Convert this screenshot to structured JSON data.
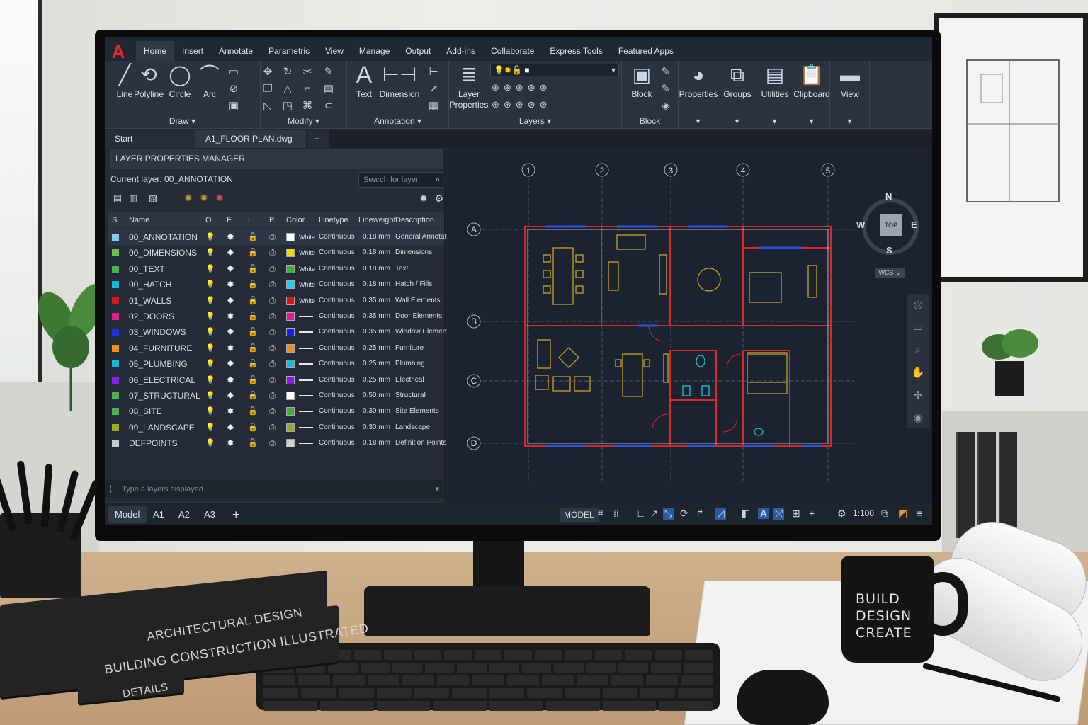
{
  "ribbon": {
    "tabs": [
      "Home",
      "Insert",
      "Annotate",
      "Parametric",
      "View",
      "Manage",
      "Output",
      "Add-ins",
      "Collaborate",
      "Express Tools",
      "Featured Apps"
    ],
    "draw": {
      "line": "Line",
      "polyline": "Polyline",
      "circle": "Circle",
      "arc": "Arc",
      "label": "Draw ▾"
    },
    "modify_label": "Modify ▾",
    "annotation": {
      "text": "Text",
      "dimension": "Dimension",
      "label": "Annotation ▾"
    },
    "layers": {
      "props_line1": "Layer",
      "props_line2": "Properties",
      "label": "Layers ▾"
    },
    "block": {
      "block": "Block",
      "label": "Block"
    },
    "properties": "Properties",
    "groups": "Groups",
    "utilities": "Utilities",
    "clipboard": "Clipboard",
    "view": "View"
  },
  "doc_tabs": {
    "start": "Start",
    "file": "A1_FLOOR PLAN.dwg",
    "close": "×",
    "add": "+"
  },
  "layer_manager": {
    "title": "LAYER PROPERTIES MANAGER",
    "current": "Current layer: 00_ANNOTATION",
    "search_placeholder": "Search for layer",
    "headers": {
      "s": "S..",
      "name": "Name",
      "o": "O.",
      "f": "F.",
      "l": "L.",
      "p": "P.",
      "color": "Color",
      "linetype": "Linetype",
      "lineweight": "Lineweight",
      "description": "Description"
    },
    "rows": [
      {
        "name": "00_ANNOTATION",
        "status_color": "#7fcfe8",
        "color": "#ffffff",
        "color_name": "White",
        "linetype": "Continuous",
        "lineweight": "0.18 mm",
        "description": "General Annotation"
      },
      {
        "name": "00_DIMENSIONS",
        "status_color": "#6ac04a",
        "color": "#f3d400",
        "color_name": "White",
        "linetype": "Continuous",
        "lineweight": "0.18 mm",
        "description": "Dimensions"
      },
      {
        "name": "00_TEXT",
        "status_color": "#4caf50",
        "color": "#3fae3a",
        "color_name": "White",
        "linetype": "Continuous",
        "lineweight": "0.18 mm",
        "description": "Text"
      },
      {
        "name": "00_HATCH",
        "status_color": "#19b5d8",
        "color": "#19d0e8",
        "color_name": "White",
        "linetype": "Continuous",
        "lineweight": "0.18 mm",
        "description": "Hatch / Fills"
      },
      {
        "name": "01_WALLS",
        "status_color": "#d11a1a",
        "color": "#e01010",
        "color_name": "White",
        "linetype": "Continuous",
        "lineweight": "0.35 mm",
        "description": "Wall Elements"
      },
      {
        "name": "02_DOORS",
        "status_color": "#e0208a",
        "color": "#e01c8c",
        "color_name": "",
        "linetype": "Continuous",
        "lineweight": "0.35 mm",
        "description": "Door Elements"
      },
      {
        "name": "03_WINDOWS",
        "status_color": "#2030e0",
        "color": "#1a1ae8",
        "color_name": "",
        "linetype": "Continuous",
        "lineweight": "0.35 mm",
        "description": "Window Elements"
      },
      {
        "name": "04_FURNITURE",
        "status_color": "#f08a18",
        "color": "#f08a18",
        "color_name": "",
        "linetype": "Continuous",
        "lineweight": "0.25 mm",
        "description": "Furniture"
      },
      {
        "name": "05_PLUMBING",
        "status_color": "#19b5d8",
        "color": "#19b8e0",
        "color_name": "",
        "linetype": "Continuous",
        "lineweight": "0.25 mm",
        "description": "Plumbing"
      },
      {
        "name": "06_ELECTRICAL",
        "status_color": "#8a20e0",
        "color": "#8a18e8",
        "color_name": "",
        "linetype": "Continuous",
        "lineweight": "0.25 mm",
        "description": "Electrical"
      },
      {
        "name": "07_STRUCTURAL",
        "status_color": "#4caf50",
        "color": "#ffffff",
        "color_name": "",
        "linetype": "Continuous",
        "lineweight": "0.50 mm",
        "description": "Structural"
      },
      {
        "name": "08_SITE",
        "status_color": "#4caf50",
        "color": "#3fae3a",
        "color_name": "",
        "linetype": "Continuous",
        "lineweight": "0.30 mm",
        "description": "Site Elements"
      },
      {
        "name": "09_LANDSCAPE",
        "status_color": "#9aaa28",
        "color": "#9aaa28",
        "color_name": "",
        "linetype": "Continuous",
        "lineweight": "0.30 mm",
        "description": "Landscape"
      },
      {
        "name": "DEFPOINTS",
        "status_color": "#c8c8c8",
        "color": "#d0d0d0",
        "color_name": "",
        "linetype": "Continuous",
        "lineweight": "0.18 mm",
        "description": "Definition Points"
      }
    ]
  },
  "command_line": {
    "placeholder": "Type a layers displayed"
  },
  "layout_tabs": [
    "Model",
    "A1",
    "A2",
    "A3"
  ],
  "layout_add": "+",
  "status_bar": {
    "model": "MODEL",
    "scale": "1:100"
  },
  "viewcube": {
    "n": "N",
    "s": "S",
    "e": "E",
    "w": "W",
    "top": "TOP",
    "wcs": "WCS ⌄"
  },
  "grid": {
    "columns": [
      "1",
      "2",
      "3",
      "4",
      "5"
    ],
    "rows": [
      "A",
      "B",
      "C",
      "D"
    ]
  },
  "desk": {
    "mug_text": [
      "BUILD",
      "DESIGN",
      "CREATE"
    ],
    "books": [
      "ARCHITECTURAL DESIGN",
      "BUILDING CONSTRUCTION ILLUSTRATED",
      "DETAILS"
    ]
  },
  "colors": {
    "accent": "#e02b2b",
    "walls": "#d8282a",
    "windows": "#2f52e0",
    "furniture": "#c9a22a",
    "fixtures": "#29c1d6"
  }
}
